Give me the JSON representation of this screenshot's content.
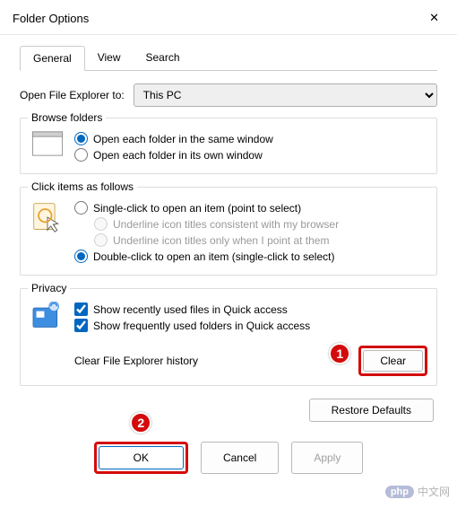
{
  "window": {
    "title": "Folder Options"
  },
  "tabs": {
    "t0": "General",
    "t1": "View",
    "t2": "Search"
  },
  "open_row": {
    "label": "Open File Explorer to:",
    "value": "This PC"
  },
  "browse": {
    "legend": "Browse folders",
    "r0": "Open each folder in the same window",
    "r1": "Open each folder in its own window"
  },
  "click": {
    "legend": "Click items as follows",
    "r0": "Single-click to open an item (point to select)",
    "sub0": "Underline icon titles consistent with my browser",
    "sub1": "Underline icon titles only when I point at them",
    "r1": "Double-click to open an item (single-click to select)"
  },
  "privacy": {
    "legend": "Privacy",
    "c0": "Show recently used files in Quick access",
    "c1": "Show frequently used folders in Quick access",
    "clear_label": "Clear File Explorer history",
    "clear_btn": "Clear"
  },
  "buttons": {
    "restore": "Restore Defaults",
    "ok": "OK",
    "cancel": "Cancel",
    "apply": "Apply"
  },
  "annotations": {
    "n1": "1",
    "n2": "2"
  },
  "watermark": {
    "logo": "php",
    "text": "中文网"
  }
}
